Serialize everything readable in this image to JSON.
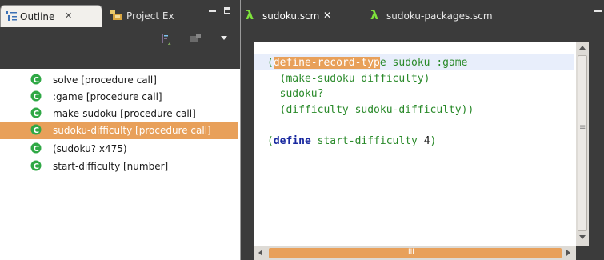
{
  "outline_view": {
    "tabs": [
      {
        "label": "Outline",
        "close": "✕"
      },
      {
        "label": "Project Ex"
      }
    ],
    "items": [
      {
        "label": "solve [procedure call]",
        "selected": false
      },
      {
        "label": ":game [procedure call]",
        "selected": false
      },
      {
        "label": "make-sudoku [procedure call]",
        "selected": false
      },
      {
        "label": "sudoku-difficulty [procedure call]",
        "selected": true
      },
      {
        "label": "(sudoku? x475)",
        "selected": false
      },
      {
        "label": "start-difficulty [number]",
        "selected": false
      }
    ]
  },
  "editor": {
    "tabs": [
      {
        "label": "sudoku.scm",
        "close": "✕",
        "icon": "lambda-icon",
        "active": true
      },
      {
        "label": "sudoku-packages.scm",
        "icon": "lambda-icon",
        "active": false
      }
    ],
    "code": {
      "l1_paren": "(",
      "l1_hl": "define-record-typ",
      "l1_rest": "e sudoku :game",
      "l2": "  (make-sudoku difficulty)",
      "l3": "  sudoku?",
      "l4": "  (difficulty sudoku-difficulty))",
      "l6_open": "(",
      "l6_kw": "define",
      "l6_mid": " start-difficulty ",
      "l6_num": "4",
      "l6_close": ")"
    },
    "scrollbar_h_label": "III",
    "scrollbar_v_label": "≡"
  },
  "colors": {
    "chrome": "#3b3b3b",
    "selection": "#e8a05a",
    "lambda": "#7ee33a",
    "icon_green": "#2fa845"
  }
}
